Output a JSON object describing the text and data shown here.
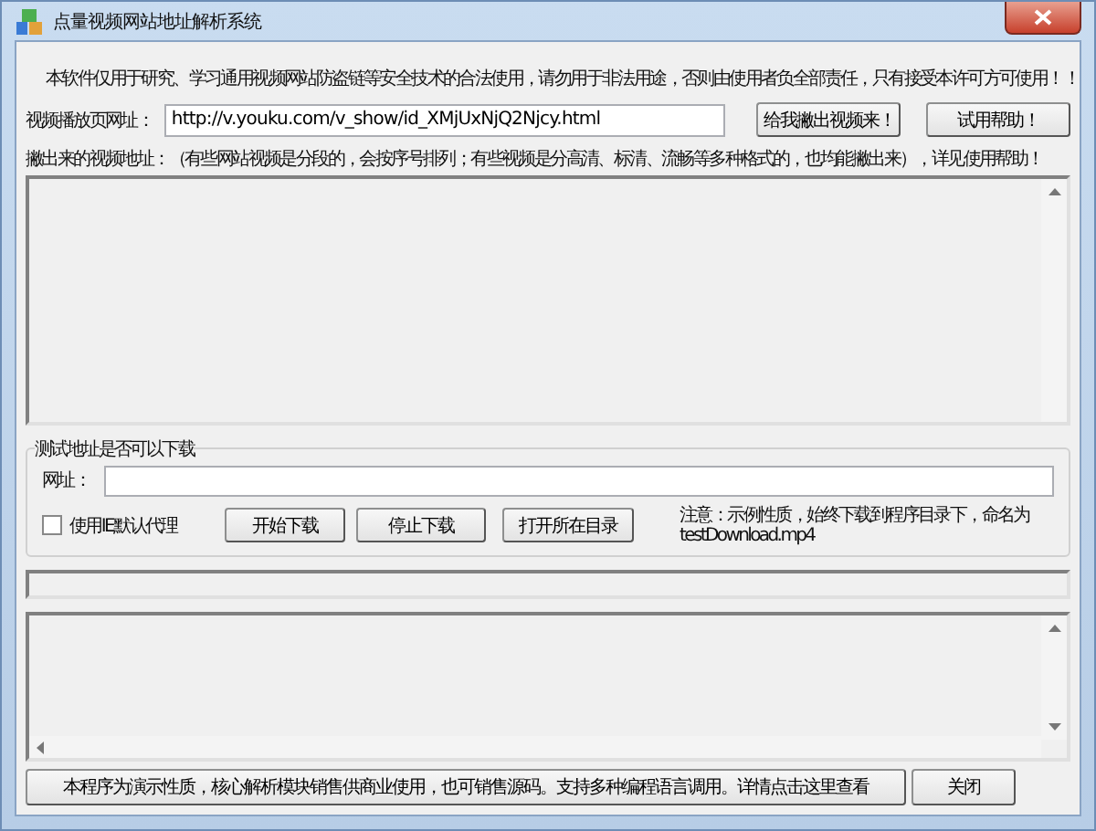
{
  "window": {
    "title": "点量视频网站地址解析系统"
  },
  "notice": "本软件仅用于研究、学习通用视频网站防盗链等安全技术的合法使用，请勿用于非法用途，否则由使用者负全部责任，只有接受本许可方可使用！！",
  "url_field": {
    "label": "视频播放页网址：",
    "value": "http://v.youku.com/v_show/id_XMjUxNjQ2Njcy.html"
  },
  "buttons": [
    "给我撇出视频来！",
    "试用帮助！"
  ],
  "result_label": "撇出来的视频地址：（有些网站视频是分段的，会按序号排列；有些视频是分高清、标清、流畅等多种格式的，也均能撇出来），详见使用帮助！",
  "download_test": {
    "title": "测试地址是否可以下载",
    "url_label": "网址：",
    "proxy": {
      "label": "使用IE默认代理",
      "checked": false
    },
    "buttons": [
      "开始下载",
      "停止下载",
      "打开所在目录"
    ],
    "note": "注意：示例性质，始终下载到程序目录下，命名为 testDownload.mp4"
  },
  "footer": {
    "info_button": "本程序为演示性质，核心解析模块销售供商业使用，也可销售源码。支持多种编程语言调用。详情点击这里查看",
    "close_button": "关闭"
  }
}
